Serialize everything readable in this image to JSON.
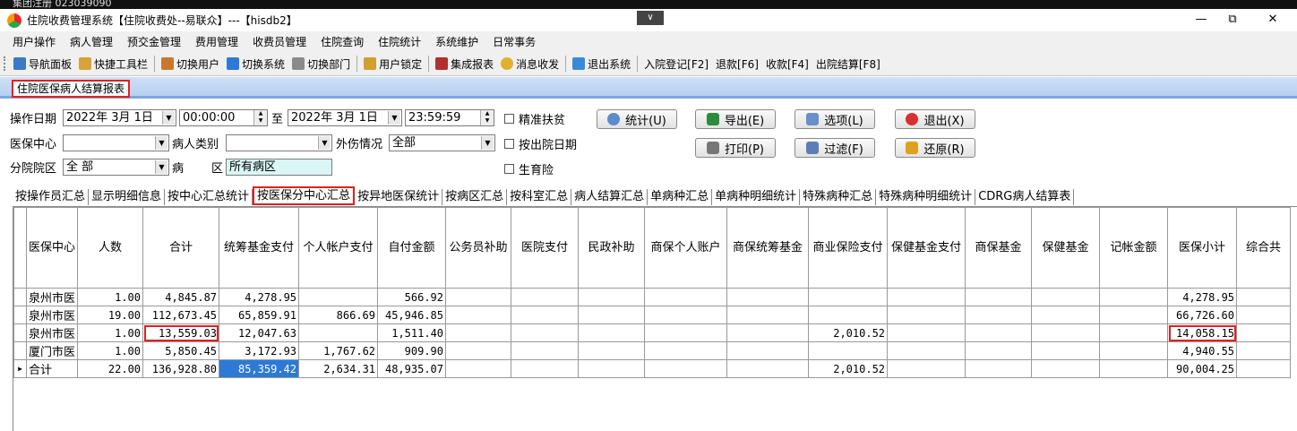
{
  "window": {
    "title": "住院收费管理系统【住院收费处--易联众】---【hisdb2】",
    "top_strip_text": "集团注册 023039090"
  },
  "menus": [
    "用户操作",
    "病人管理",
    "预交金管理",
    "费用管理",
    "收费员管理",
    "住院查询",
    "住院统计",
    "系统维护",
    "日常事务"
  ],
  "toolbar": [
    "导航面板",
    "快捷工具栏",
    "切换用户",
    "切换系统",
    "切换部门",
    "用户锁定",
    "集成报表",
    "消息收发",
    "退出系统",
    "入院登记[F2]",
    "退款[F6]",
    "收款[F4]",
    "出院结算[F8]"
  ],
  "doc_tab": "住院医保病人结算报表",
  "filters": {
    "op_date_label": "操作日期",
    "date_from": "2022年  3月  1日",
    "time_from": "00:00:00",
    "to_label": "至",
    "date_to": "2022年  3月  1日",
    "time_to": "23:59:59",
    "insurance_center_label": "医保中心",
    "insurance_center_value": "",
    "patient_type_label": "病人类别",
    "patient_type_value": "",
    "injury_label": "外伤情况",
    "injury_value": "全部",
    "branch_label": "分院院区",
    "branch_value": "全  部",
    "ward_label_a": "病",
    "ward_label_b": "区",
    "ward_value": "所有病区",
    "checkboxes": [
      "精准扶贫",
      "按出院日期",
      "生育险"
    ]
  },
  "actions": {
    "stats": "统计(U)",
    "export": "导出(E)",
    "options": "选项(L)",
    "quit": "退出(X)",
    "print": "打印(P)",
    "filter": "过滤(F)",
    "restore": "还原(R)"
  },
  "report_tabs": [
    "按操作员汇总",
    "显示明细信息",
    "按中心汇总统计",
    "按医保分中心汇总",
    "按异地医保统计",
    "按病区汇总",
    "按科室汇总",
    "病人结算汇总",
    "单病种汇总",
    "单病种明细统计",
    "特殊病种汇总",
    "特殊病种明细统计",
    "CDRG病人结算表"
  ],
  "active_report_tab": 3,
  "grid": {
    "columns": [
      "医保中心",
      "人数",
      "合计",
      "统筹基金支付",
      "个人帐户支付",
      "自付金额",
      "公务员补助",
      "医院支付",
      "民政补助",
      "商保个人账户",
      "商保统筹基金",
      "商业保险支付",
      "保健基金支付",
      "商保基金",
      "保健基金",
      "记帐金额",
      "医保小计",
      "综合共"
    ],
    "rows": [
      [
        "泉州市医",
        "1.00",
        "4,845.87",
        "4,278.95",
        "",
        "566.92",
        "",
        "",
        "",
        "",
        "",
        "",
        "",
        "",
        "",
        "",
        "4,278.95",
        ""
      ],
      [
        "泉州市医",
        "19.00",
        "112,673.45",
        "65,859.91",
        "866.69",
        "45,946.85",
        "",
        "",
        "",
        "",
        "",
        "",
        "",
        "",
        "",
        "",
        "66,726.60",
        ""
      ],
      [
        "泉州市医",
        "1.00",
        "13,559.03",
        "12,047.63",
        "",
        "1,511.40",
        "",
        "",
        "",
        "",
        "",
        "2,010.52",
        "",
        "",
        "",
        "",
        "14,058.15",
        ""
      ],
      [
        "厦门市医",
        "1.00",
        "5,850.45",
        "3,172.93",
        "1,767.62",
        "909.90",
        "",
        "",
        "",
        "",
        "",
        "",
        "",
        "",
        "",
        "",
        "4,940.55",
        ""
      ],
      [
        "合计",
        "22.00",
        "136,928.80",
        "85,359.42",
        "2,634.31",
        "48,935.07",
        "",
        "",
        "",
        "",
        "",
        "2,010.52",
        "",
        "",
        "",
        "",
        "90,004.25",
        ""
      ]
    ],
    "current_row_marker": "▶"
  }
}
